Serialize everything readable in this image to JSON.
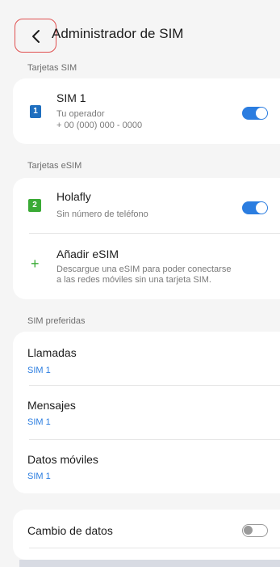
{
  "header": {
    "title": "Administrador de SIM"
  },
  "sim_cards": {
    "label": "Tarjetas SIM",
    "sim1": {
      "badge": "1",
      "title": "SIM 1",
      "operator": "Tu operador",
      "number": "+ 00 (000) 000 - 0000",
      "enabled": true
    }
  },
  "esim_cards": {
    "label": "Tarjetas eSIM",
    "holafly": {
      "badge": "2",
      "title": "Holafly",
      "subtitle": "Sin número de teléfono",
      "enabled": true
    },
    "add_esim": {
      "icon": "+",
      "title": "Añadir eSIM",
      "description_line1": "Descargue una eSIM para poder conectarse",
      "description_line2": "a las redes móviles sin una tarjeta SIM."
    }
  },
  "preferred": {
    "label": "SIM preferidas",
    "calls": {
      "title": "Llamadas",
      "value": "SIM 1"
    },
    "messages": {
      "title": "Mensajes",
      "value": "SIM 1"
    },
    "mobile_data": {
      "title": "Datos móviles",
      "value": "SIM 1"
    }
  },
  "data_switch": {
    "title": "Cambio de datos",
    "enabled": false
  },
  "colors": {
    "accent": "#2b7de0",
    "sim1_badge": "#1f6fbf",
    "sim2_badge": "#3aaa35"
  },
  "icons": {
    "back": "chevron-left-icon",
    "add": "plus-icon"
  }
}
